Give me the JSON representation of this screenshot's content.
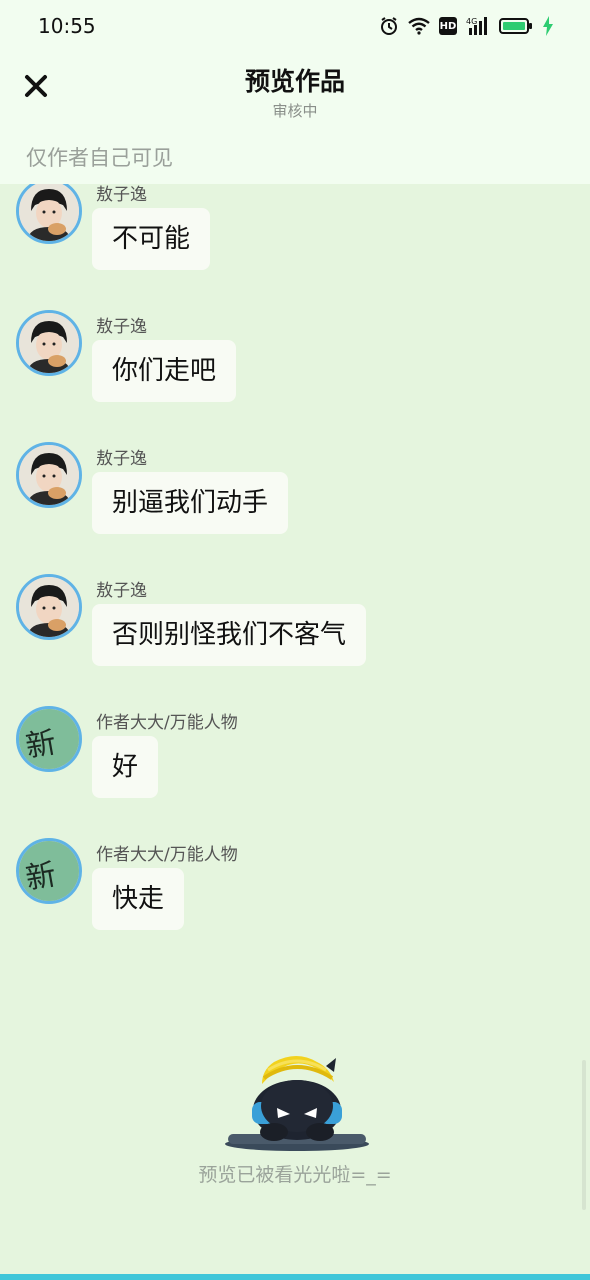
{
  "status_bar": {
    "time": "10:55",
    "icons": [
      "alarm-icon",
      "wifi-icon",
      "hd-icon",
      "signal-4g-icon",
      "battery-icon",
      "charging-icon"
    ],
    "hd_label": "HD",
    "battery_color": "#2ecc71"
  },
  "header": {
    "close_icon": "close-icon",
    "title": "预览作品",
    "subtitle": "审核中",
    "visibility_note": "仅作者自己可见"
  },
  "messages": [
    {
      "sender": "敖子逸",
      "text": "不可能",
      "avatar": "photo-avatar"
    },
    {
      "sender": "敖子逸",
      "text": "你们走吧",
      "avatar": "photo-avatar"
    },
    {
      "sender": "敖子逸",
      "text": "别逼我们动手",
      "avatar": "photo-avatar"
    },
    {
      "sender": "敖子逸",
      "text": "否则别怪我们不客气",
      "avatar": "photo-avatar"
    },
    {
      "sender": "作者大大/万能人物",
      "text": "好",
      "avatar": "author-avatar"
    },
    {
      "sender": "作者大大/万能人物",
      "text": "快走",
      "avatar": "author-avatar"
    }
  ],
  "author_avatar_text": "新",
  "footer": {
    "end_note": "预览已被看光光啦=_=",
    "illustration": "mascot-illustration"
  },
  "colors": {
    "background": "#e5f5de",
    "header": "#f2fdf0",
    "bubble": "#f8fbf4",
    "avatar_ring": "#5fb3e6",
    "accent_bottom": "#3fc6d9"
  }
}
